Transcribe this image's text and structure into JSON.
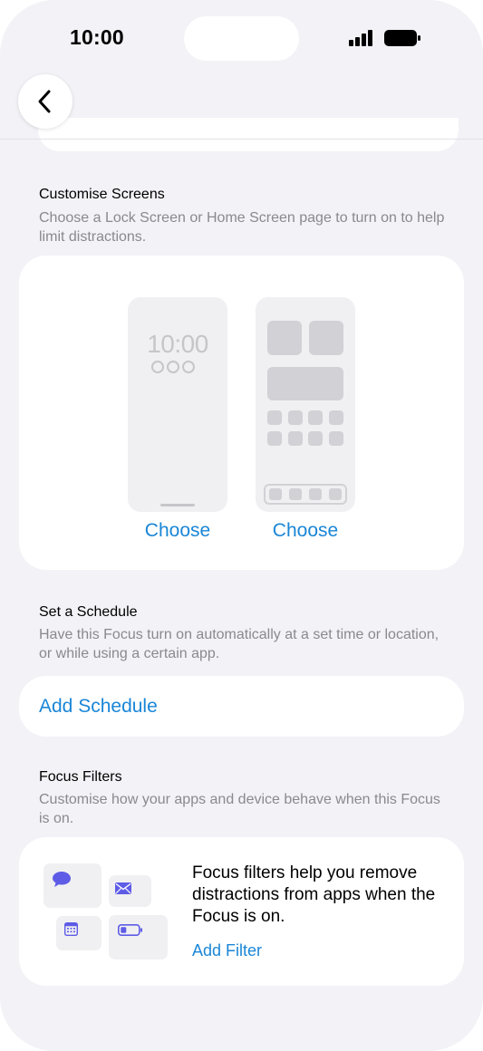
{
  "status_bar": {
    "time": "10:00"
  },
  "sections": {
    "customise": {
      "title": "Customise Screens",
      "description": "Choose a Lock Screen or Home Screen page to turn on to help limit distractions.",
      "lock_screen_time": "10:00",
      "choose_lock_label": "Choose",
      "choose_home_label": "Choose"
    },
    "schedule": {
      "title": "Set a Schedule",
      "description": "Have this Focus turn on automatically at a set time or location, or while using a certain app.",
      "add_label": "Add Schedule"
    },
    "filters": {
      "title": "Focus Filters",
      "description": "Customise how your apps and device behave when this Focus is on.",
      "info_text": "Focus filters help you remove distractions from apps when the Focus is on.",
      "add_label": "Add Filter",
      "icons": [
        "message-icon",
        "mail-icon",
        "calendar-icon",
        "battery-icon"
      ]
    }
  },
  "colors": {
    "background": "#f2f2f7",
    "card": "#ffffff",
    "link": "#1a86d6",
    "secondary_text": "#8a8a8e",
    "icon_purple": "#5e5ce6"
  }
}
